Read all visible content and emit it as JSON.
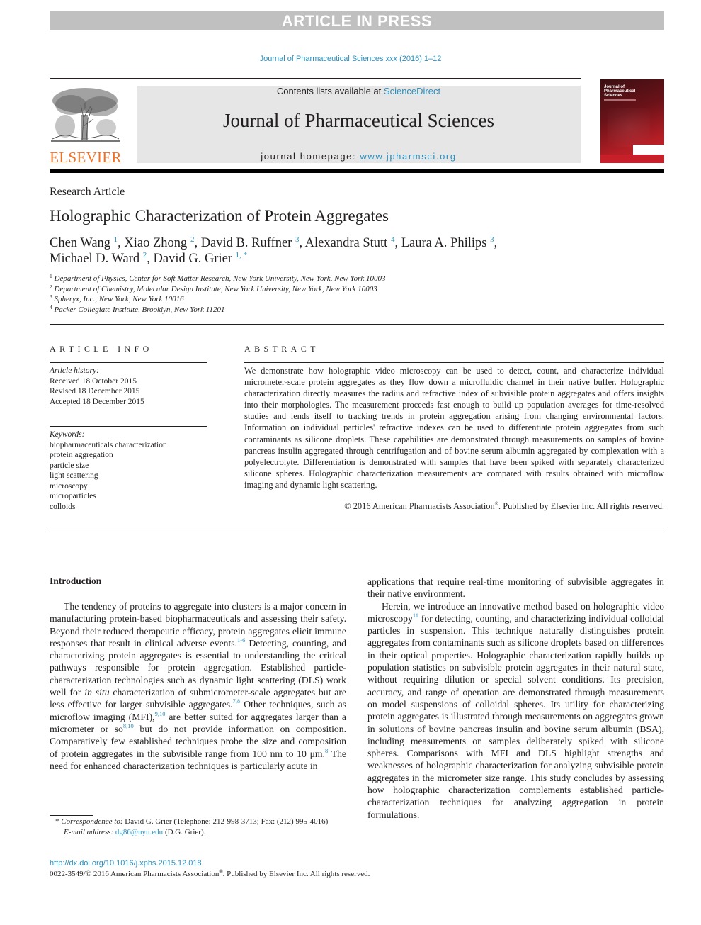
{
  "banner": {
    "text": "ARTICLE IN PRESS"
  },
  "citation": "Journal of Pharmaceutical Sciences xxx (2016) 1–12",
  "masthead": {
    "publisher_logo": "ELSEVIER",
    "contents_prefix": "Contents lists available at ",
    "contents_link": "ScienceDirect",
    "journal_title": "Journal of Pharmaceutical Sciences",
    "homepage_prefix": "journal homepage: ",
    "homepage_link": "www.jpharmsci.org",
    "cover_title_lines": [
      "Journal of",
      "Pharmaceutical",
      "Sciences"
    ]
  },
  "article": {
    "type": "Research Article",
    "title": "Holographic Characterization of Protein Aggregates",
    "authors": [
      {
        "name": "Chen Wang",
        "aff": "1",
        "sep": ", "
      },
      {
        "name": "Xiao Zhong",
        "aff": "2",
        "sep": ", "
      },
      {
        "name": "David B. Ruffner",
        "aff": "3",
        "sep": ", "
      },
      {
        "name": "Alexandra Stutt",
        "aff": "4",
        "sep": ", "
      },
      {
        "name": "Laura A. Philips",
        "aff": "3",
        "sep": ","
      },
      {
        "name": "Michael D. Ward",
        "aff": "2",
        "sep": ", "
      },
      {
        "name": "David G. Grier",
        "aff": "1, *",
        "sep": ""
      }
    ],
    "affiliations": [
      {
        "num": "1",
        "text": "Department of Physics, Center for Soft Matter Research, New York University, New York, New York 10003"
      },
      {
        "num": "2",
        "text": "Department of Chemistry, Molecular Design Institute, New York University, New York, New York 10003"
      },
      {
        "num": "3",
        "text": "Spheryx, Inc., New York, New York 10016"
      },
      {
        "num": "4",
        "text": "Packer Collegiate Institute, Brooklyn, New York 11201"
      }
    ]
  },
  "article_info": {
    "heading": "ARTICLE INFO",
    "history_label": "Article history:",
    "history": [
      "Received 18 October 2015",
      "Revised 18 December 2015",
      "Accepted 18 December 2015"
    ],
    "keywords_label": "Keywords:",
    "keywords": [
      "biopharmaceuticals characterization",
      "protein aggregation",
      "particle size",
      "light scattering",
      "microscopy",
      "microparticles",
      "colloids"
    ]
  },
  "abstract": {
    "heading": "ABSTRACT",
    "text": "We demonstrate how holographic video microscopy can be used to detect, count, and characterize individual micrometer-scale protein aggregates as they flow down a microfluidic channel in their native buffer. Holographic characterization directly measures the radius and refractive index of subvisible protein aggregates and offers insights into their morphologies. The measurement proceeds fast enough to build up population averages for time-resolved studies and lends itself to tracking trends in protein aggregation arising from changing environmental factors. Information on individual particles' refractive indexes can be used to differentiate protein aggregates from such contaminants as silicone droplets. These capabilities are demonstrated through measurements on samples of bovine pancreas insulin aggregated through centrifugation and of bovine serum albumin aggregated by complexation with a polyelectrolyte. Differentiation is demonstrated with samples that have been spiked with separately characterized silicone spheres. Holographic characterization measurements are compared with results obtained with microflow imaging and dynamic light scattering.",
    "copyright_a": "© 2016 American Pharmacists Association",
    "copyright_reg": "®",
    "copyright_b": ". Published by Elsevier Inc. All rights reserved."
  },
  "intro": {
    "heading": "Introduction",
    "p1": [
      "The tendency of proteins to aggregate into clusters is a major concern in manufacturing protein-based biopharmaceuticals and assessing their safety. Beyond their reduced therapeutic efficacy, protein aggregates elicit immune responses that result in clinical adverse events.",
      "1-6",
      " Detecting, counting, and characterizing protein aggregates is essential to understanding the critical pathways responsible for protein aggregation. Established particle-characterization technologies such as dynamic light scattering (DLS) work well for ",
      "in situ",
      " characterization of submicrometer-scale aggregates but are less effective for larger subvisible aggregates.",
      "7,8",
      " Other techniques, such as microflow imaging (MFI),",
      "9,10",
      " are better suited for aggregates larger than a micrometer or so",
      "8,10",
      " but do not provide information on composition. Comparatively few established techniques probe the size and composition of protein aggregates in the subvisible range from 100 nm to 10 μm.",
      "8",
      " The need for enhanced characterization techniques is particularly acute in applications that require real-time monitoring of subvisible aggregates in their native environment."
    ],
    "p2": [
      "Herein, we introduce an innovative method based on holographic video microscopy",
      "11",
      " for detecting, counting, and characterizing individual colloidal particles in suspension. This technique naturally distinguishes protein aggregates from contaminants such as silicone droplets based on differences in their optical properties. Holographic characterization rapidly builds up population statistics on subvisible protein aggregates in their natural state, without requiring dilution or special solvent conditions. Its precision, accuracy, and range of operation are demonstrated through measurements on model suspensions of colloidal spheres. Its utility for characterizing protein aggregates is illustrated through measurements on aggregates grown in solutions of bovine pancreas insulin and bovine serum albumin (BSA), including measurements on samples deliberately spiked with silicone spheres. Comparisons with MFI and DLS highlight strengths and weaknesses of holographic characterization for analyzing subvisible protein aggregates in the micrometer size range. This study concludes by assessing how holographic characterization complements established particle-characterization techniques for analyzing aggregation in protein formulations."
    ]
  },
  "footnote": {
    "marker": "* ",
    "label": "Correspondence to:",
    "text": " David G. Grier (Telephone: 212-998-3713; Fax: (212) 995-4016)",
    "email_label": "E-mail address:",
    "email": "dg86@nyu.edu",
    "email_suffix": " (D.G. Grier)."
  },
  "doi": "http://dx.doi.org/10.1016/j.xphs.2015.12.018",
  "issn": {
    "a": "0022-3549/© 2016 American Pharmacists Association",
    "reg": "®",
    "b": ". Published by Elsevier Inc. All rights reserved."
  }
}
